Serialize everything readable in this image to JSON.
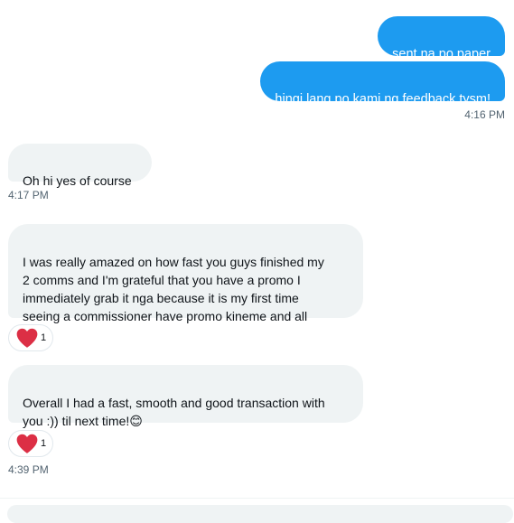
{
  "messages": {
    "sent_1": "sent na po paper",
    "sent_2": "hingi lang po kami ng feedback tysm!",
    "sent_time": "4:16 PM",
    "recv_1": "Oh hi yes of course",
    "recv_1_time": "4:17 PM",
    "recv_2": "I was really amazed on how fast you guys finished my\n2 comms and I'm grateful that you have a promo I\nimmediately grab it nga because it is my first time\nseeing a commissioner have promo kineme and all",
    "recv_2_reaction": {
      "icon": "heart-icon",
      "count": "1"
    },
    "recv_3": "Overall I had a fast, smooth and good transaction with\nyou :)) til next time!",
    "recv_3_emoji": "😊",
    "recv_3_reaction": {
      "icon": "heart-icon",
      "count": "1"
    },
    "recv_3_time": "4:39 PM"
  },
  "colors": {
    "sent_bubble": "#1d9bf0",
    "received_bubble": "#eff3f4",
    "heart": "#f91880",
    "timestamp": "#536471"
  }
}
